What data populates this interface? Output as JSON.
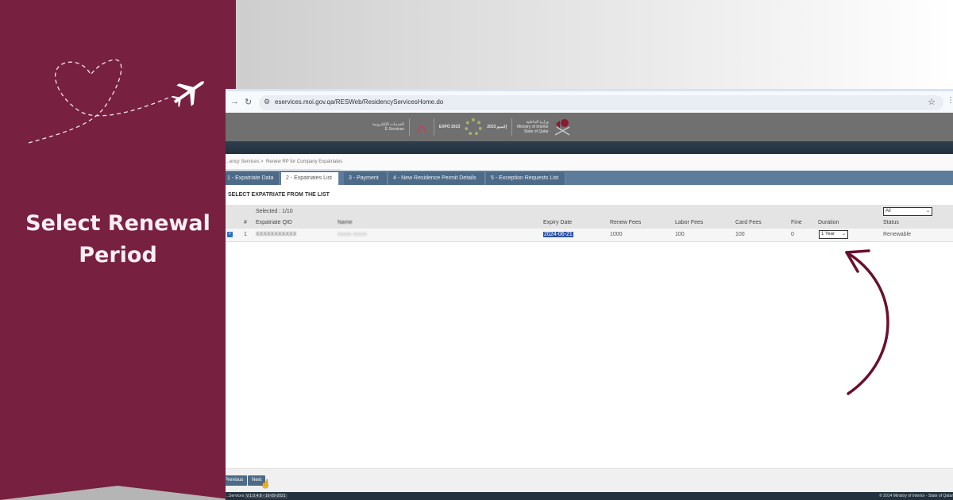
{
  "left_panel": {
    "title_line1": "Select Renewal",
    "title_line2": "Period",
    "background_color": "#782040",
    "decoration": [
      "heart-dashed-path",
      "airplane-icon"
    ]
  },
  "browser": {
    "url": "eservices.moi.gov.qa/RESWeb/ResidencyServicesHome.do",
    "icons": [
      "forward-arrow-icon",
      "reload-icon",
      "site-settings-icon",
      "bookmark-star-icon",
      "menu-icon"
    ]
  },
  "site_header": {
    "eservices_arabic": "الخدمات الإلكترونية",
    "eservices_label": "E-Services",
    "expo_label": "EXPO 2023",
    "expo_arabic": "إكسبو 2023",
    "ministry_arabic": "وزارة الداخلية",
    "ministry_label": "Ministry of Interior",
    "ministry_sub": "State of Qatar"
  },
  "breadcrumb": {
    "items": [
      "...ency Services",
      "Renew RP for Company Expatriates"
    ],
    "separator": ">"
  },
  "tabs": [
    {
      "label": "1 - Expatriate Data",
      "active": false
    },
    {
      "label": "2 - Expatriates List",
      "active": true
    },
    {
      "label": "3 - Payment",
      "active": false
    },
    {
      "label": "4 - New Residence Permit Details",
      "active": false
    },
    {
      "label": "5 - Exception Requests List",
      "active": false
    }
  ],
  "section": {
    "title": "SELECT EXPATRIATE FROM THE LIST",
    "selected_count": "Selected : 1/10",
    "status_filter": "All"
  },
  "table": {
    "columns": [
      "#",
      "Expatriate QID",
      "Name",
      "Expiry Date",
      "Renew Fees",
      "Labor Fees",
      "Card Fees",
      "Fine",
      "Duration",
      "Status"
    ],
    "rows": [
      {
        "checked": true,
        "index": "1",
        "qid": "XXXXXXXXXXX",
        "name": "xxxxx                 xxxxx",
        "expiry_date": "2024-06-21",
        "renew_fees": "1000",
        "labor_fees": "100",
        "card_fees": "100",
        "fine": "0",
        "duration": "1 Year",
        "status": "Renewable"
      }
    ]
  },
  "buttons": {
    "previous": "Previous",
    "next": "Next"
  },
  "footer": {
    "left": "...Services",
    "version": "V.1.0.4.8 - 16-09-2021",
    "right": "© 2014 Ministry of Interior - State of Qatar"
  },
  "annotation": {
    "arrow_color": "#6b0f2f",
    "points_to": "duration-select"
  }
}
